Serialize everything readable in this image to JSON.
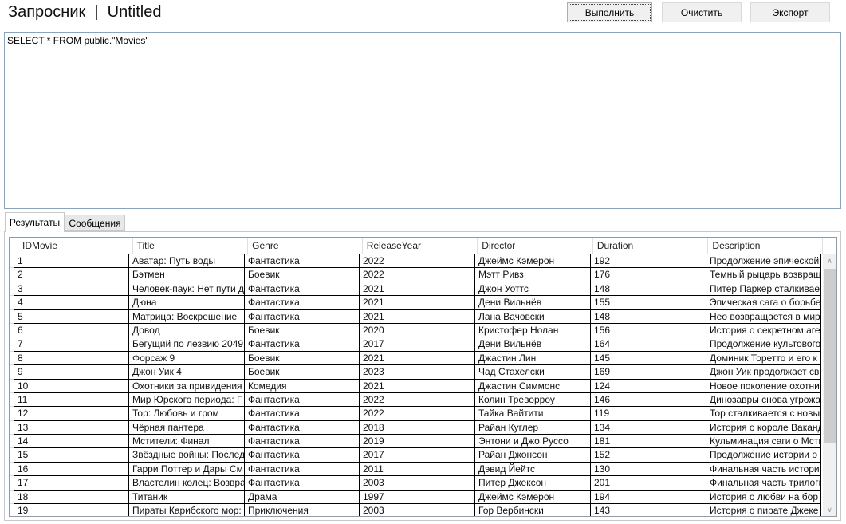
{
  "header": {
    "title": "Запросник  |  Untitled"
  },
  "toolbar": {
    "run": "Выполнить",
    "clear": "Очистить",
    "export": "Экспорт"
  },
  "editor": {
    "query": "SELECT * FROM public.\"Movies\""
  },
  "tabs": [
    {
      "label": "Результаты",
      "active": true
    },
    {
      "label": "Сообщения",
      "active": false
    }
  ],
  "grid": {
    "columns": [
      "IDMovie",
      "Title",
      "Genre",
      "ReleaseYear",
      "Director",
      "Duration",
      "Description"
    ],
    "rows": [
      [
        "1",
        "Аватар: Путь воды",
        "Фантастика",
        "2022",
        "Джеймс Кэмерон",
        "192",
        "Продолжение эпической"
      ],
      [
        "2",
        "Бэтмен",
        "Боевик",
        "2022",
        "Мэтт Ривз",
        "176",
        "Темный рыцарь возвращ"
      ],
      [
        "3",
        "Человек-паук: Нет пути д",
        "Фантастика",
        "2021",
        "Джон Уоттс",
        "148",
        "Питер Паркер сталкивает"
      ],
      [
        "4",
        "Дюна",
        "Фантастика",
        "2021",
        "Дени Вильнёв",
        "155",
        "Эпическая сага о борьбе"
      ],
      [
        "5",
        "Матрица: Воскрешение",
        "Фантастика",
        "2021",
        "Лана Вачовски",
        "148",
        "Нео возвращается в мир"
      ],
      [
        "6",
        "Довод",
        "Боевик",
        "2020",
        "Кристофер Нолан",
        "156",
        "История о секретном аге"
      ],
      [
        "7",
        "Бегущий по лезвию 2049",
        "Фантастика",
        "2017",
        "Дени Вильнёв",
        "164",
        "Продолжение культового"
      ],
      [
        "8",
        "Форсаж 9",
        "Боевик",
        "2021",
        "Джастин Лин",
        "145",
        "Доминик Торетто и его к"
      ],
      [
        "9",
        "Джон Уик 4",
        "Боевик",
        "2023",
        "Чад Стахелски",
        "169",
        "Джон Уик продолжает св"
      ],
      [
        "10",
        "Охотники за привидения",
        "Комедия",
        "2021",
        "Джастин Симмонс",
        "124",
        "Новое поколение охотни"
      ],
      [
        "11",
        "Мир Юрского периода: Г",
        "Фантастика",
        "2022",
        "Колин Треворроу",
        "146",
        "Динозавры снова угрожа"
      ],
      [
        "12",
        "Тор: Любовь и гром",
        "Фантастика",
        "2022",
        "Тайка Вайтити",
        "119",
        "Тор сталкивается с новы"
      ],
      [
        "13",
        "Чёрная пантера",
        "Фантастика",
        "2018",
        "Райан Куглер",
        "134",
        "История о короле Ваканд"
      ],
      [
        "14",
        "Мстители: Финал",
        "Фантастика",
        "2019",
        "Энтони и Джо Руссо",
        "181",
        "Кульминация саги о Мсти"
      ],
      [
        "15",
        "Звёздные войны: Послед",
        "Фантастика",
        "2017",
        "Райан Джонсон",
        "152",
        "Продолжение истории о"
      ],
      [
        "16",
        "Гарри Поттер и Дары См",
        "Фантастика",
        "2011",
        "Дэвид Йейтс",
        "130",
        "Финальная часть истории"
      ],
      [
        "17",
        "Властелин колец: Возвра",
        "Фантастика",
        "2003",
        "Питер Джексон",
        "201",
        "Финальная часть трилоги"
      ],
      [
        "18",
        "Титаник",
        "Драма",
        "1997",
        "Джеймс Кэмерон",
        "194",
        "История о любви на бор"
      ],
      [
        "19",
        "Пираты Карибского мор:",
        "Приключения",
        "2003",
        "Гор Вербински",
        "143",
        "История о пирате Джеке"
      ]
    ]
  }
}
